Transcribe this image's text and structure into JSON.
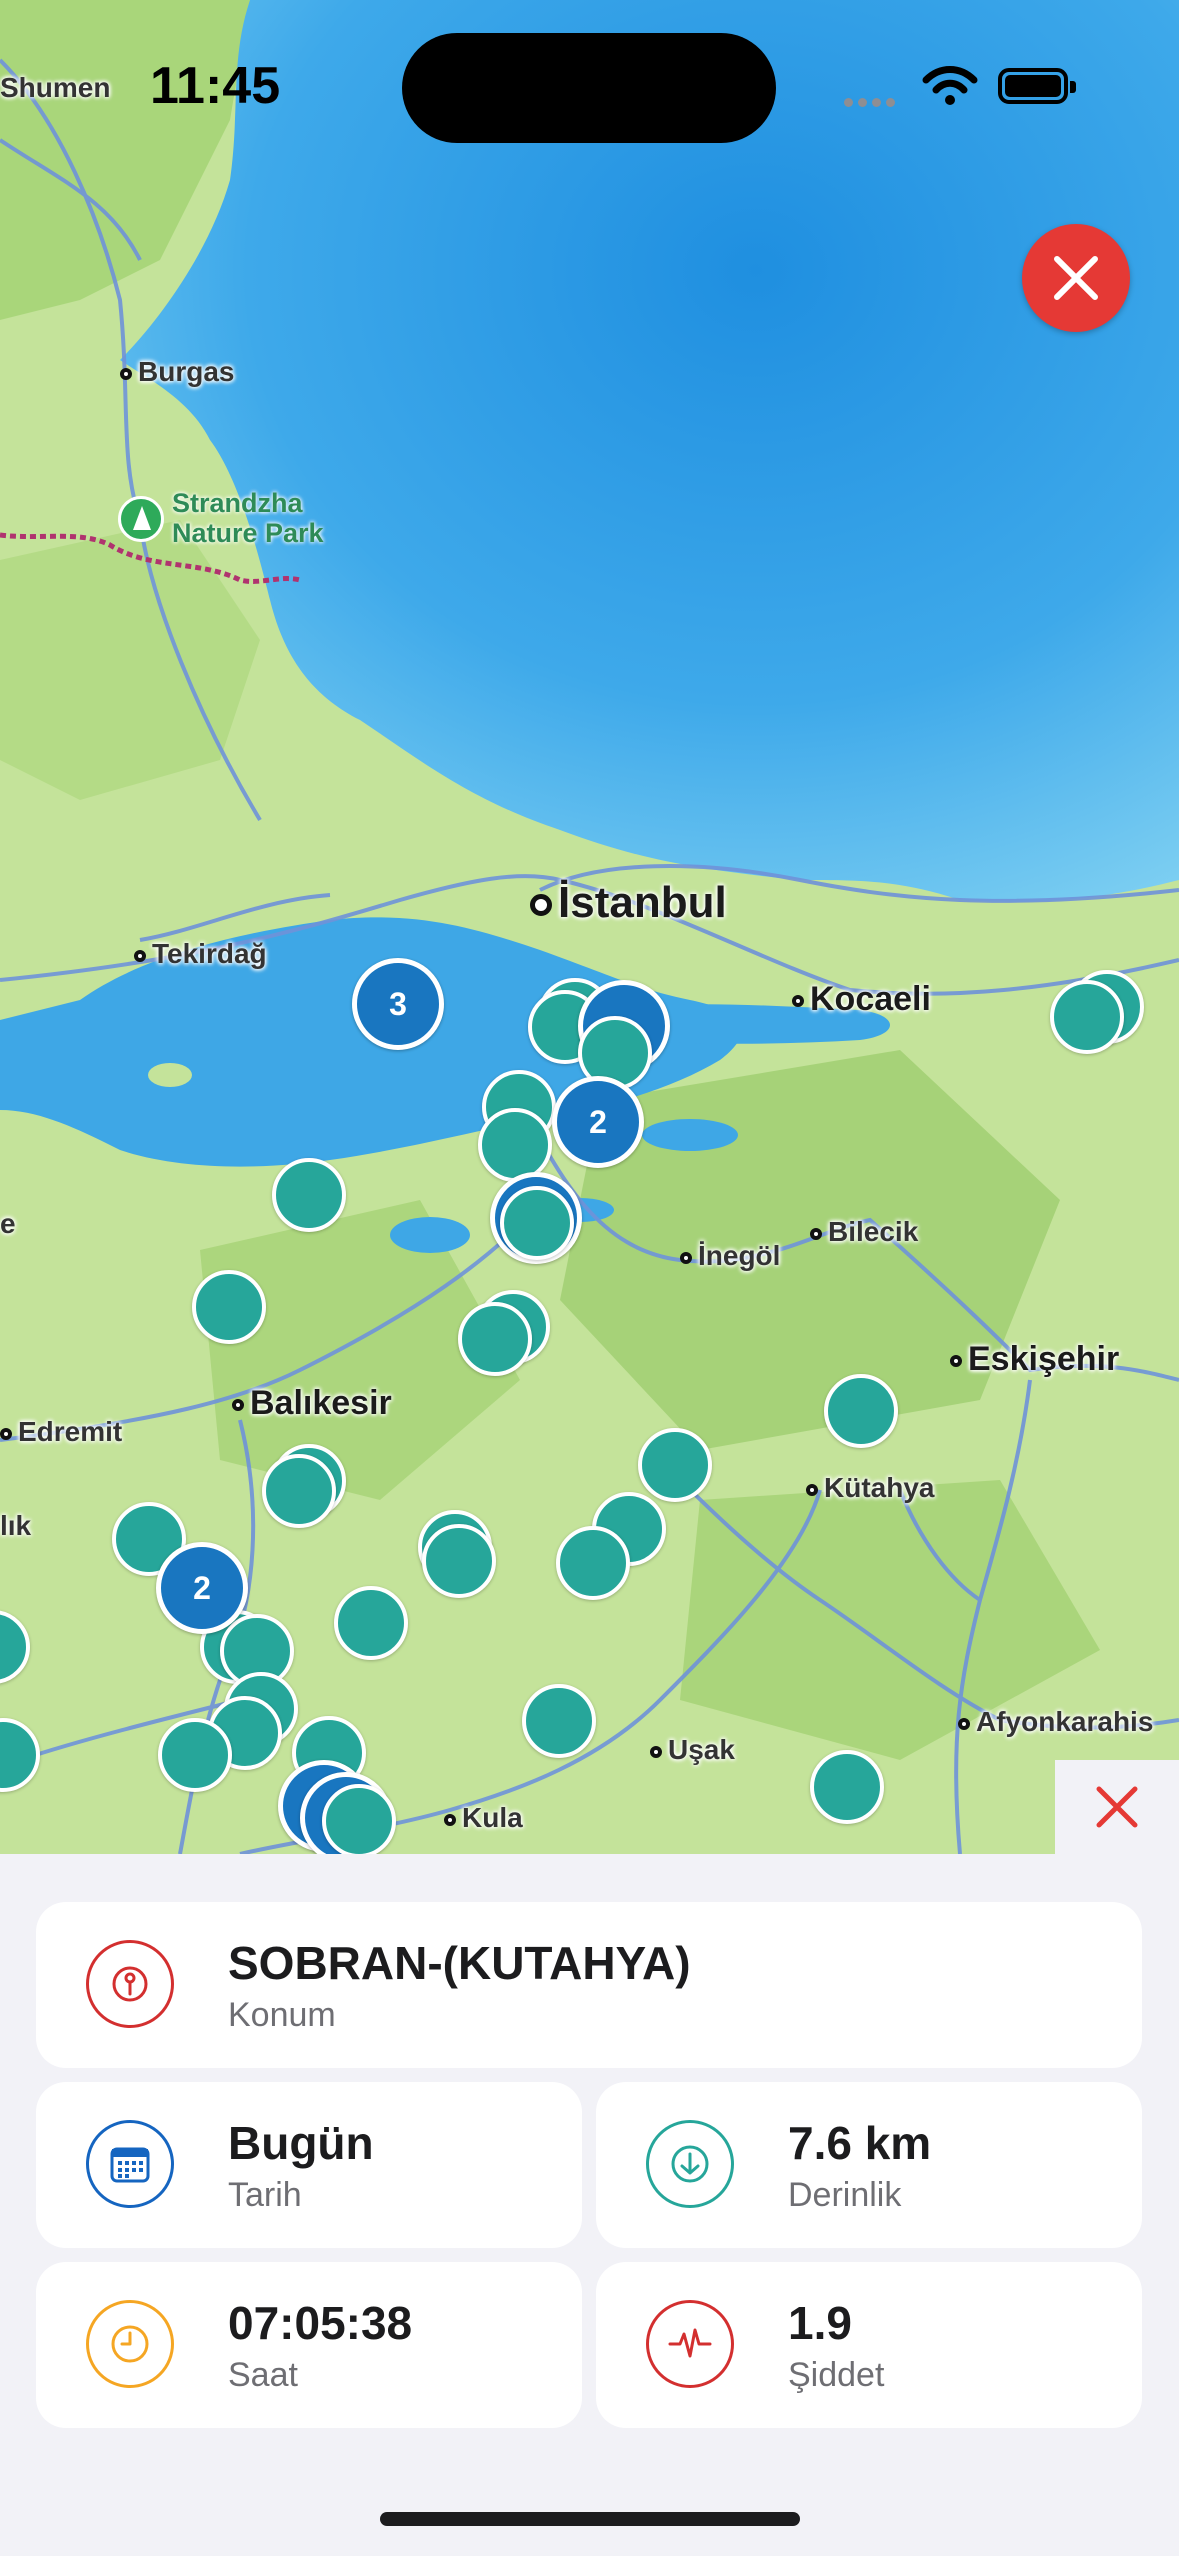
{
  "status_bar": {
    "time": "11:45"
  },
  "map": {
    "places": {
      "shumen": "Shumen",
      "burgas": "Burgas",
      "park": "Strandzha\nNature Park",
      "istanbul": "İstanbul",
      "tekirdag": "Tekirdağ",
      "kocaeli": "Kocaeli",
      "inegol": "İnegöl",
      "bilecik": "Bilecik",
      "eskisehir": "Eskişehir",
      "balikesir": "Balıkesir",
      "edremit": "Edremit",
      "kutahya": "Kütahya",
      "usak": "Uşak",
      "kula": "Kula",
      "afyon": "Afyonkarahis",
      "edge_e": "e",
      "edge_lik": "lık"
    },
    "clusters": [
      "3",
      "2",
      "2"
    ]
  },
  "detail": {
    "location": {
      "value": "SOBRAN-(KUTAHYA)",
      "label": "Konum"
    },
    "date": {
      "value": "Bugün",
      "label": "Tarih"
    },
    "depth": {
      "value": "7.6 km",
      "label": "Derinlik"
    },
    "time": {
      "value": "07:05:38",
      "label": "Saat"
    },
    "magnitude": {
      "value": "1.9",
      "label": "Şiddet"
    }
  },
  "colors": {
    "sea": "#3aa8e8",
    "land": "#bfe08f",
    "quake": "#26a69a",
    "cluster": "#1976c0",
    "close": "#e53935",
    "location_icon": "#d32f2f",
    "date_icon": "#1565c0",
    "depth_icon": "#26a69a",
    "time_icon": "#f5a623",
    "magnitude_icon": "#d32f2f"
  },
  "icons": {
    "location": "map-pin-icon",
    "date": "calendar-icon",
    "depth": "arrow-down-circle-icon",
    "time": "clock-icon",
    "magnitude": "waveform-icon"
  }
}
